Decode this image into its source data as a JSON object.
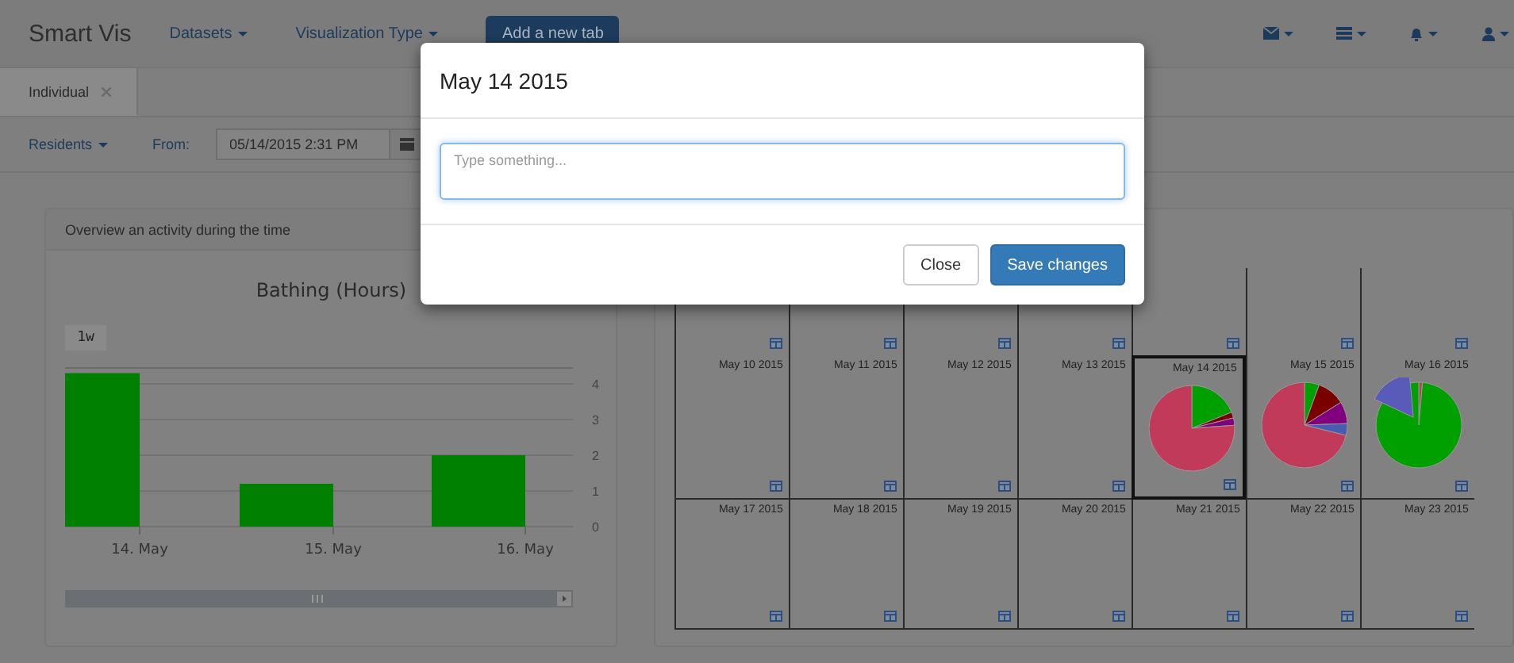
{
  "navbar": {
    "brand": "Smart Vis",
    "menus": [
      {
        "label": "Datasets"
      },
      {
        "label": "Visualization Type"
      }
    ],
    "add_tab_button": "Add a new tab",
    "icon_menus": [
      {
        "kind": "mail"
      },
      {
        "kind": "list"
      },
      {
        "kind": "bell"
      },
      {
        "kind": "user"
      }
    ]
  },
  "tabs": [
    {
      "label": "Individual"
    }
  ],
  "filters": {
    "residents": "Residents",
    "from_label": "From:",
    "from_value": "05/14/2015 2:31 PM"
  },
  "activity_panel": {
    "heading": "Overview an activity during the time",
    "range_button": "1w",
    "chart_data": {
      "type": "bar",
      "title": "Bathing (Hours)",
      "categories": [
        "14. May",
        "15. May",
        "16. May"
      ],
      "grid": true,
      "series": [
        {
          "color": "#008000",
          "values": [
            4.3,
            1.2,
            2.0
          ]
        }
      ],
      "ylim": [
        0,
        4.5
      ],
      "yticks": [
        0,
        1,
        2,
        3,
        4
      ]
    }
  },
  "calendar": {
    "weeks": [
      [
        {
          "kind": "empty",
          "selected": false
        },
        {
          "kind": "empty",
          "selected": false
        },
        {
          "kind": "empty",
          "selected": false
        },
        {
          "kind": "empty",
          "selected": false
        },
        {
          "kind": "empty",
          "selected": false
        },
        {
          "kind": "empty",
          "selected": false
        },
        {
          "kind": "empty",
          "selected": false
        }
      ],
      [
        {
          "date": "May 10 2015",
          "kind": "empty",
          "selected": false
        },
        {
          "date": "May 11 2015",
          "kind": "empty",
          "selected": false
        },
        {
          "date": "May 12 2015",
          "kind": "empty",
          "selected": false
        },
        {
          "date": "May 13 2015",
          "kind": "empty",
          "selected": false
        },
        {
          "date": "May 14 2015",
          "kind": "pie",
          "selected": true
        },
        {
          "date": "May 15 2015",
          "kind": "pie",
          "selected": false
        },
        {
          "date": "May 16 2015",
          "kind": "pie",
          "selected": false
        }
      ],
      [
        {
          "date": "May 17 2015",
          "kind": "empty",
          "selected": false
        },
        {
          "date": "May 18 2015",
          "kind": "empty",
          "selected": false
        },
        {
          "date": "May 19 2015",
          "kind": "empty",
          "selected": false
        },
        {
          "date": "May 20 2015",
          "kind": "empty",
          "selected": false
        },
        {
          "date": "May 21 2015",
          "kind": "empty",
          "selected": false
        },
        {
          "date": "May 22 2015",
          "kind": "empty",
          "selected": false
        },
        {
          "date": "May 23 2015",
          "kind": "empty",
          "selected": false
        }
      ]
    ]
  },
  "modal": {
    "title": "May 14 2015",
    "placeholder": "Type something...",
    "buttons": [
      {
        "label": "Close",
        "kind": "default"
      },
      {
        "label": "Save changes",
        "kind": "primary"
      }
    ]
  }
}
